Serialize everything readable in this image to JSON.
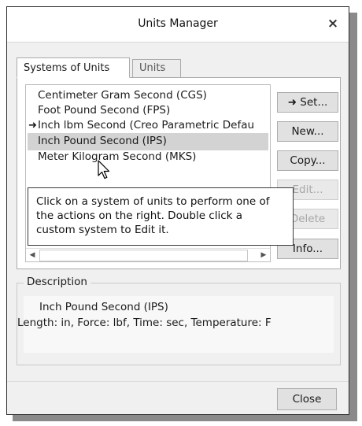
{
  "window": {
    "title": "Units Manager",
    "close_glyph": "×"
  },
  "tabs": [
    {
      "label": "Systems of Units",
      "active": true
    },
    {
      "label": "Units",
      "active": false
    }
  ],
  "systems_list": {
    "items": [
      {
        "label": "Centimeter Gram Second (CGS)",
        "marker": ""
      },
      {
        "label": "Foot Pound Second (FPS)",
        "marker": ""
      },
      {
        "label": "Inch lbm Second (Creo Parametric Defau",
        "marker": "➜"
      },
      {
        "label": "Inch Pound Second (IPS)",
        "marker": ""
      },
      {
        "label": "Meter Kilogram Second (MKS)",
        "marker": ""
      }
    ],
    "selected_index": 3
  },
  "buttons": {
    "set": "➜ Set...",
    "new": "New...",
    "copy": "Copy...",
    "edit": "Edit...",
    "delete": "Delete",
    "info": "Info..."
  },
  "tooltip": {
    "text": "Click on a system of units to perform one of the actions on the right. Double click a custom system to Edit it."
  },
  "description": {
    "legend": "Description",
    "name": "Inch Pound Second (IPS)",
    "details": "Length: in, Force: lbf, Time: sec, Temperature: F"
  },
  "footer": {
    "close_label": "Close"
  },
  "icons": {
    "cursor": "mouse-pointer-icon",
    "current_marker": "arrow-right-icon",
    "scroll_left": "chevron-left-icon",
    "scroll_right": "chevron-right-icon"
  },
  "colors": {
    "selected_row": "#d3d3d3",
    "dialog_bg": "#f0f0f0",
    "title_bg": "#ffffff"
  }
}
